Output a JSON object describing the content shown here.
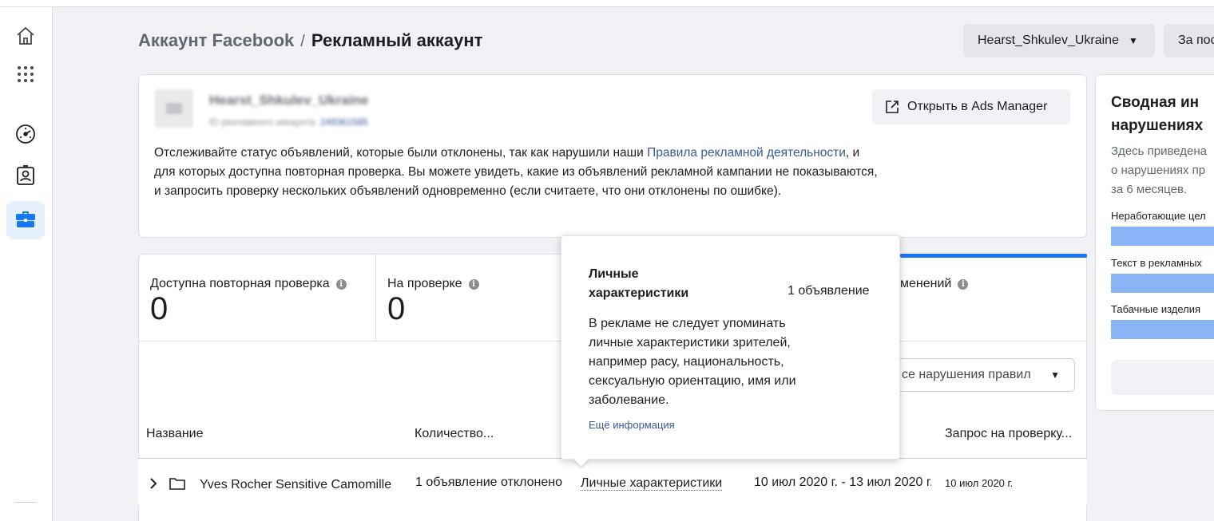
{
  "breadcrumb": {
    "parent": "Аккаунт Facebook",
    "separator": "/",
    "current": "Рекламный аккаунт"
  },
  "header": {
    "account_selector": "Hearst_Shkulev_Ukraine",
    "period_button": "За пос"
  },
  "account": {
    "name": "Hearst_Shkulev_Ukraine",
    "id_label": "ID рекламного аккаунта:",
    "id_value": "249361585"
  },
  "open_ads_manager": "Открыть в Ads Manager",
  "description": {
    "part1": "Отслеживайте статус объявлений, которые были отклонены, так как нарушили наши ",
    "link": "Правила рекламной деятельности",
    "part2": ", и для которых доступна повторная проверка. Вы можете увидеть, какие из объявлений рекламной кампании не показываются, и запросить проверку нескольких объявлений одновременно (если считаете, что они отклонены по ошибке)."
  },
  "stats": [
    {
      "label": "Доступна повторная проверка",
      "value": "0"
    },
    {
      "label": "На проверке",
      "value": "0"
    },
    {
      "label": "менений",
      "value": ""
    }
  ],
  "filter": {
    "selected": "се нарушения правил"
  },
  "table": {
    "columns": [
      "Название",
      "Количество...",
      "Запрос на проверку..."
    ],
    "rows": [
      {
        "name": "Yves Rocher Sensitive Camomille",
        "count": "1 объявление отклонено",
        "reason": "Личные характеристики",
        "period": "10 июл 2020 г. - 13 июл 2020 г.",
        "request": "10 июл 2020 г."
      }
    ]
  },
  "tooltip": {
    "title": "Личные характеристики",
    "count": "1 объявление",
    "body": "В рекламе не следует упоминать личные характеристики зрителей, например расу, национальность, сексуальную ориентацию, имя или заболевание.",
    "more_link": "Ещё информация"
  },
  "side_panel": {
    "title_line1": "Сводная ин",
    "title_line2": "нарушениях",
    "sub_line1": "Здесь приведена",
    "sub_line2": "о нарушениях пр",
    "sub_line3": "за 6 месяцев.",
    "items": [
      "Неработающие цел",
      "Текст в рекламных",
      "Табачные изделия"
    ]
  },
  "colors": {
    "accent": "#1877f2",
    "link": "#385898",
    "bar": "#8ab4f8",
    "active_nav": "#e7f0fd"
  },
  "nav_icons": [
    "home-icon",
    "apps-grid-icon",
    "dashboard-gauge-icon",
    "id-card-icon",
    "briefcase-icon"
  ]
}
